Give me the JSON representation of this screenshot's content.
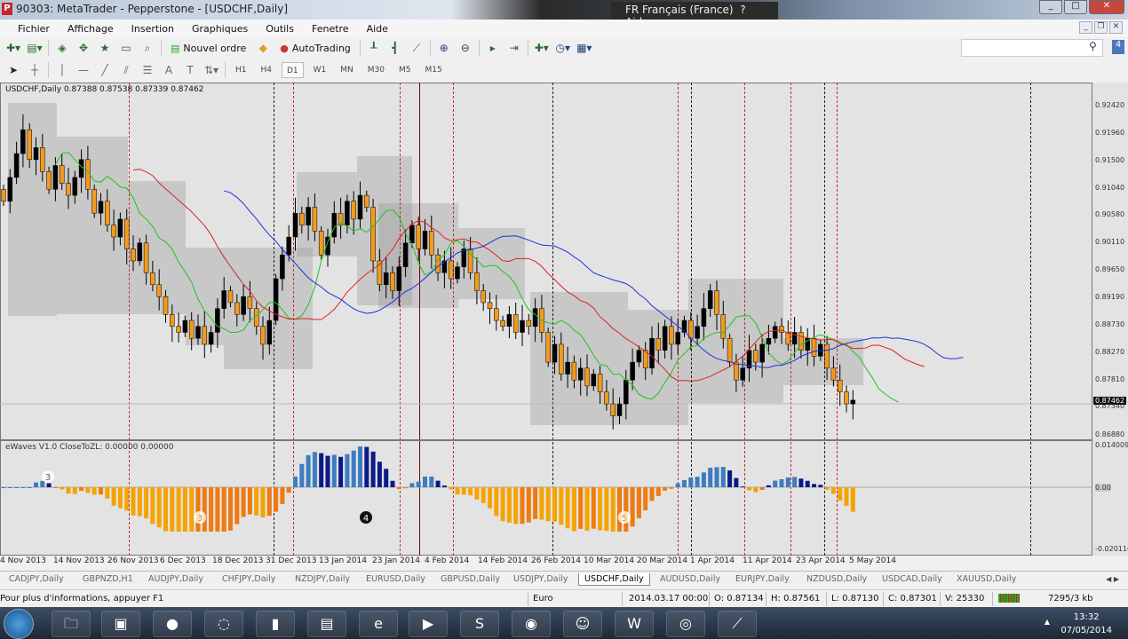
{
  "window": {
    "title": "90303: MetaTrader - Pepperstone - [USDCHF,Daily]",
    "logo": "P",
    "language": "FR Français (France)",
    "help": "Aide"
  },
  "menu": [
    "Fichier",
    "Affichage",
    "Insertion",
    "Graphiques",
    "Outils",
    "Fenetre",
    "Aide"
  ],
  "toolbar": {
    "new_order": "Nouvel ordre",
    "autotrading": "AutoTrading",
    "notification_count": "4",
    "search_placeholder": ""
  },
  "timeframes": [
    "H1",
    "H4",
    "D1",
    "W1",
    "MN",
    "M30",
    "M5",
    "M15"
  ],
  "active_timeframe": "D1",
  "chart": {
    "header": "USDCHF,Daily  0.87388 0.87538 0.87339 0.87462",
    "indicator_header": "eWaves V1.0 CloseToZL: 0.00000 0.00000",
    "current_price": "0.87462",
    "bid_label": "0.87340",
    "wave_labels": [
      "3",
      "3",
      "4",
      "5"
    ]
  },
  "chart_data": {
    "type": "candlestick",
    "symbol": "USDCHF",
    "timeframe": "Daily",
    "price_ticks": [
      "0.92420",
      "0.91960",
      "0.91500",
      "0.91040",
      "0.90580",
      "0.90110",
      "0.89650",
      "0.89190",
      "0.88730",
      "0.88270",
      "0.87810",
      "0.86880"
    ],
    "ylim": [
      0.8688,
      0.9242
    ],
    "indicator_ticks": [
      "0.014009",
      "0.00",
      "-0.020116"
    ],
    "date_ticks": [
      "4 Nov 2013",
      "14 Nov 2013",
      "26 Nov 2013",
      "6 Dec 2013",
      "18 Dec 2013",
      "31 Dec 2013",
      "13 Jan 2014",
      "23 Jan 2014",
      "4 Feb 2014",
      "14 Feb 2014",
      "26 Feb 2014",
      "10 Mar 2014",
      "20 Mar 2014",
      "1 Apr 2014",
      "11 Apr 2014",
      "23 Apr 2014",
      "5 May 2014"
    ],
    "closes": [
      0.908,
      0.912,
      0.916,
      0.92,
      0.915,
      0.917,
      0.913,
      0.91,
      0.914,
      0.911,
      0.909,
      0.912,
      0.915,
      0.91,
      0.906,
      0.908,
      0.904,
      0.902,
      0.905,
      0.9,
      0.898,
      0.901,
      0.896,
      0.894,
      0.892,
      0.889,
      0.887,
      0.886,
      0.888,
      0.885,
      0.887,
      0.884,
      0.886,
      0.89,
      0.893,
      0.891,
      0.889,
      0.892,
      0.89,
      0.887,
      0.884,
      0.888,
      0.895,
      0.899,
      0.902,
      0.906,
      0.904,
      0.907,
      0.903,
      0.899,
      0.902,
      0.906,
      0.904,
      0.908,
      0.905,
      0.909,
      0.907,
      0.898,
      0.894,
      0.896,
      0.893,
      0.897,
      0.901,
      0.904,
      0.9,
      0.903,
      0.899,
      0.896,
      0.898,
      0.895,
      0.897,
      0.9,
      0.896,
      0.893,
      0.891,
      0.89,
      0.888,
      0.887,
      0.889,
      0.886,
      0.888,
      0.887,
      0.89,
      0.886,
      0.881,
      0.884,
      0.879,
      0.881,
      0.878,
      0.88,
      0.877,
      0.879,
      0.876,
      0.874,
      0.872,
      0.874,
      0.878,
      0.881,
      0.883,
      0.88,
      0.885,
      0.883,
      0.887,
      0.884,
      0.886,
      0.888,
      0.885,
      0.887,
      0.89,
      0.893,
      0.889,
      0.885,
      0.881,
      0.878,
      0.88,
      0.883,
      0.881,
      0.884,
      0.885,
      0.887,
      0.886,
      0.884,
      0.886,
      0.883,
      0.885,
      0.882,
      0.884,
      0.88,
      0.878,
      0.876,
      0.874,
      0.87462
    ],
    "ma_periods": [
      5,
      13,
      21
    ],
    "ma_colors": [
      "#22c322",
      "#e02020",
      "#2030e0"
    ]
  },
  "tabs": [
    "CADJPY,Daily",
    "GBPNZD,H1",
    "AUDJPY,Daily",
    "CHFJPY,Daily",
    "NZDJPY,Daily",
    "EURUSD,Daily",
    "GBPUSD,Daily",
    "USDJPY,Daily",
    "USDCHF,Daily",
    "AUDUSD,Daily",
    "EURJPY,Daily",
    "NZDUSD,Daily",
    "USDCAD,Daily",
    "XAUUSD,Daily"
  ],
  "active_tab": "USDCHF,Daily",
  "status": {
    "help": "Pour plus d'informations, appuyer F1",
    "profile": "Euro",
    "time": "2014.03.17 00:00",
    "open": "O: 0.87134",
    "high": "H: 0.87561",
    "low": "L: 0.87130",
    "close": "C: 0.87301",
    "volume": "V: 25330",
    "traffic": "7295/3 kb"
  },
  "taskbar": {
    "time": "13:32",
    "date": "07/05/2014"
  }
}
